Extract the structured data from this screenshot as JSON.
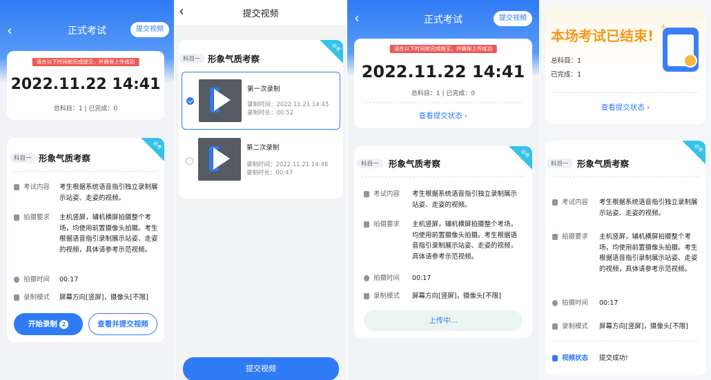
{
  "s1": {
    "back": "‹",
    "title": "正式考试",
    "submit_pill": "提交视频",
    "banner": "请在以下时间前完成提交，并确保上传成功",
    "datetime": "2022.11.22 14:41",
    "summary": "总科目：1 | 已完成：0",
    "corner": "必考",
    "subject_tag": "科目一",
    "subject_name": "形象气质考察",
    "rows": [
      {
        "label": "考试内容",
        "value": "考生根据系统语音指引独立录制展示站姿、走姿的视频。"
      },
      {
        "label": "拍摄要求",
        "value": "主机竖屏，辅机横屏拍摄整个考场，均使用前置摄像头拍摄。考生根据语音指引录制展示站姿、走姿的视频，具体请参考示范视频。"
      },
      {
        "label": "拍摄时间",
        "value": "00:17"
      },
      {
        "label": "录制模式",
        "value": "屏幕方向[竖屏]，摄像头[不限]"
      }
    ],
    "start_btn": "开始录制",
    "start_badge": "2",
    "view_btn": "查看并提交视频"
  },
  "s2": {
    "back": "‹",
    "title": "提交视频",
    "corner": "必考",
    "subject_tag": "科目一",
    "subject_name": "形象气质考察",
    "videos": [
      {
        "title": "第一次录制",
        "time": "录制时间：2022.11.21 14:45",
        "duration": "录制时长：00:52"
      },
      {
        "title": "第二次录制",
        "time": "录制时间：2022.11.21 14:46",
        "duration": "录制时长：00:47"
      }
    ],
    "submit_btn": "提交视频"
  },
  "s3": {
    "back": "‹",
    "title": "正式考试",
    "submit_pill": "提交视频",
    "banner": "请在以下时间前完成提交，并确保上传成功",
    "datetime": "2022.11.22 14:41",
    "summary": "总科目：1 | 已完成：0",
    "status_link": "查看提交状态 ›",
    "corner": "必考",
    "subject_tag": "科目一",
    "subject_name": "形象气质考察",
    "rows": [
      {
        "label": "考试内容",
        "value": "考生根据系统语音指引独立录制展示站姿、走姿的视频。"
      },
      {
        "label": "拍摄要求",
        "value": "主机竖屏，辅机横屏拍摄整个考场，均使用前置摄像头拍摄。考生根据语音指引录制展示站姿、走姿的视频，具体请参考示范视频。"
      },
      {
        "label": "拍摄时间",
        "value": "00:17"
      },
      {
        "label": "录制模式",
        "value": "屏幕方向[竖屏]，摄像头[不限]"
      }
    ],
    "uploading": "上传中..."
  },
  "s4": {
    "ended": "本场考试已结束!",
    "total": "总科目：1",
    "done": "已完成：1",
    "status_link": "查看提交状态 ›",
    "corner": "必考",
    "subject_tag": "科目一",
    "subject_name": "形象气质考察",
    "rows": [
      {
        "label": "考试内容",
        "value": "考生根据系统语音指引独立录制展示站姿、走姿的视频。"
      },
      {
        "label": "拍摄要求",
        "value": "主机竖屏，辅机横屏拍摄整个考场，均使用前置摄像头拍摄。考生根据语音指引录制展示站姿、走姿的视频，具体请参考示范视频。"
      },
      {
        "label": "拍摄时间",
        "value": "00:17"
      },
      {
        "label": "录制模式",
        "value": "屏幕方向[竖屏]，摄像头[不限]"
      }
    ],
    "video_status_label": "视频状态",
    "video_status_value": "提交成功!"
  },
  "colors": {
    "primary": "#2f7bf5",
    "banner": "#ec5a58",
    "corner": "#35c2ea",
    "ended": "#f39a1b"
  }
}
